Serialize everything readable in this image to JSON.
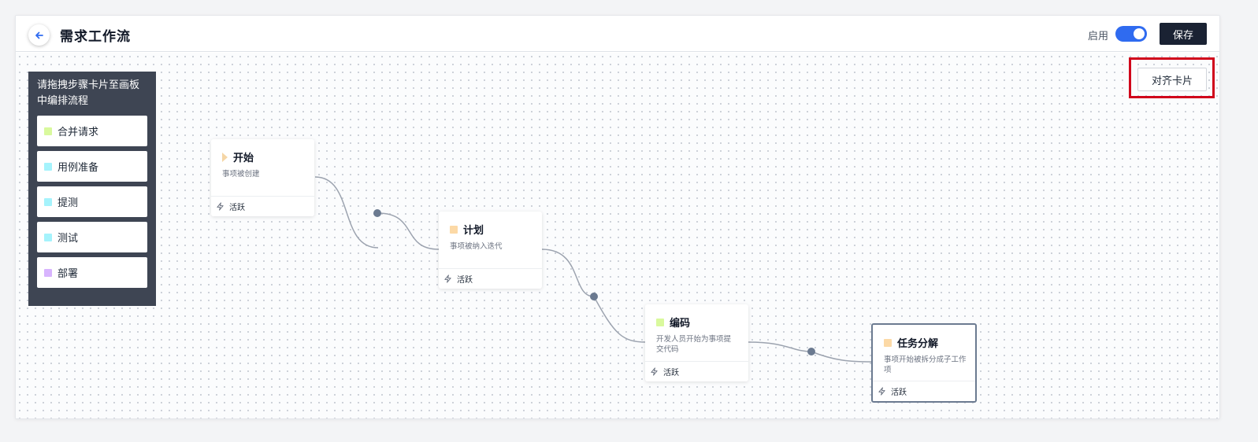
{
  "header": {
    "title": "需求工作流",
    "enable_label": "启用",
    "enabled": true,
    "save_label": "保存"
  },
  "palette": {
    "hint": "请拖拽步骤卡片至画板中编排流程",
    "items": [
      {
        "label": "合并请求",
        "color": "#d9f99d"
      },
      {
        "label": "用例准备",
        "color": "#a5f3fc"
      },
      {
        "label": "提测",
        "color": "#a5f3fc"
      },
      {
        "label": "测试",
        "color": "#a5f3fc"
      },
      {
        "label": "部署",
        "color": "#d8b4fe"
      }
    ]
  },
  "canvas": {
    "align_label": "对齐卡片"
  },
  "nodes": [
    {
      "title": "开始",
      "desc": "事项被创建",
      "status": "活跃",
      "marker": "triangle",
      "color": "#f5d6a6"
    },
    {
      "title": "计划",
      "desc": "事项被纳入迭代",
      "status": "活跃",
      "marker": "square",
      "color": "#fcd9a6"
    },
    {
      "title": "编码",
      "desc": "开发人员开始为事项提交代码",
      "status": "活跃",
      "marker": "square",
      "color": "#d9f99d"
    },
    {
      "title": "任务分解",
      "desc": "事项开始被拆分成子工作项",
      "status": "活跃",
      "marker": "square",
      "color": "#fcd9a6",
      "selected": true
    }
  ],
  "colors": {
    "accent": "#2f6bf0",
    "primary_button": "#1a2233",
    "palette_bg": "#3e4553",
    "highlight": "#d0021b"
  }
}
